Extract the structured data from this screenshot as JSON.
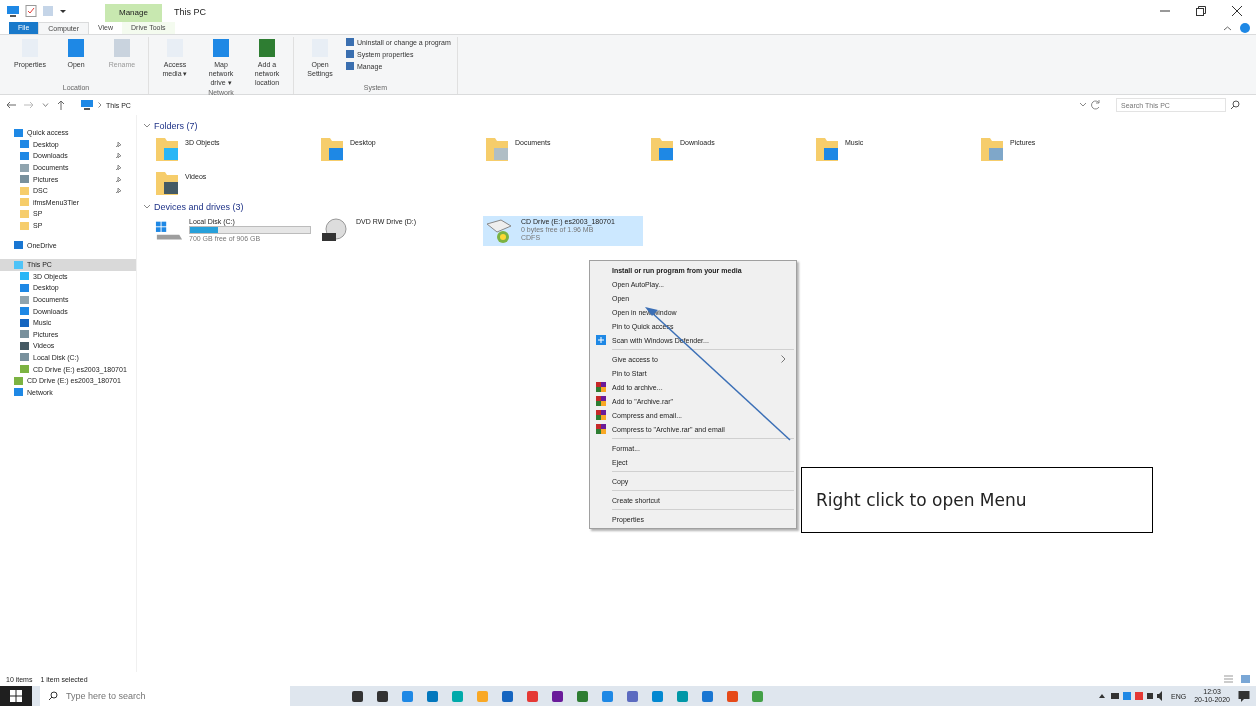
{
  "window": {
    "title": "This PC",
    "context_tab": "Manage"
  },
  "ribbon_tabs": [
    {
      "label": "File",
      "selected": false,
      "kind": "file"
    },
    {
      "label": "Computer",
      "selected": true,
      "kind": "tab"
    },
    {
      "label": "View",
      "selected": false,
      "kind": "tab"
    },
    {
      "label": "Drive Tools",
      "selected": false,
      "kind": "context"
    }
  ],
  "ribbon_groups": [
    {
      "name": "Location",
      "buttons": [
        {
          "label": "Properties",
          "disabled": false
        },
        {
          "label": "Open",
          "disabled": false
        },
        {
          "label": "Rename",
          "disabled": true
        }
      ]
    },
    {
      "name": "Network",
      "buttons": [
        {
          "label": "Access media ▾",
          "disabled": false
        },
        {
          "label": "Map network drive ▾",
          "disabled": false
        },
        {
          "label": "Add a network location",
          "disabled": false
        }
      ]
    },
    {
      "name": "System",
      "buttons": [
        {
          "label": "Open Settings",
          "disabled": false
        }
      ],
      "small_buttons": [
        "Uninstall or change a program",
        "System properties",
        "Manage"
      ]
    }
  ],
  "address": {
    "path": "This PC",
    "search_placeholder": "Search This PC"
  },
  "sidebar": [
    {
      "label": "Quick access",
      "selected": false,
      "children": [
        {
          "label": "Desktop",
          "pinned": true
        },
        {
          "label": "Downloads",
          "pinned": true
        },
        {
          "label": "Documents",
          "pinned": true
        },
        {
          "label": "Pictures",
          "pinned": true
        },
        {
          "label": "DSC",
          "pinned": true
        },
        {
          "label": "ifmsMenu3Tier",
          "pinned": false
        },
        {
          "label": "SP",
          "pinned": false
        },
        {
          "label": "SP",
          "pinned": false
        }
      ]
    },
    {
      "label": "OneDrive",
      "selected": false
    },
    {
      "label": "This PC",
      "selected": true,
      "children": [
        {
          "label": "3D Objects",
          "pinned": false
        },
        {
          "label": "Desktop",
          "pinned": false
        },
        {
          "label": "Documents",
          "pinned": false
        },
        {
          "label": "Downloads",
          "pinned": false
        },
        {
          "label": "Music",
          "pinned": false
        },
        {
          "label": "Pictures",
          "pinned": false
        },
        {
          "label": "Videos",
          "pinned": false
        },
        {
          "label": "Local Disk (C:)",
          "pinned": false
        },
        {
          "label": "CD Drive (E:) es2003_180701",
          "pinned": false
        }
      ]
    },
    {
      "label": "CD Drive (E:) es2003_180701",
      "selected": false
    },
    {
      "label": "Network",
      "selected": false
    }
  ],
  "folders": {
    "heading": "Folders (7)",
    "expanded": true,
    "items": [
      "3D Objects",
      "Desktop",
      "Documents",
      "Downloads",
      "Music",
      "Pictures",
      "Videos"
    ]
  },
  "drives": {
    "heading": "Devices and drives (3)",
    "expanded": true,
    "items": [
      {
        "name": "Local Disk (C:)",
        "level": 0.23,
        "detail": "700 GB free of 906 GB",
        "kind": "disk",
        "selected": false
      },
      {
        "name": "DVD RW Drive (D:)",
        "kind": "dvd",
        "selected": false
      },
      {
        "name": "CD Drive (E:) es2003_180701",
        "detail": "0 bytes free of 1.96 MB",
        "filesystem": "CDFS",
        "kind": "cd",
        "selected": true
      }
    ]
  },
  "context_menu": [
    {
      "label": "Install or run program from your media",
      "kind": "bold"
    },
    {
      "label": "Open AutoPlay...",
      "kind": "plain"
    },
    {
      "label": "Open",
      "kind": "plain"
    },
    {
      "label": "Open in new window",
      "kind": "plain"
    },
    {
      "label": "Pin to Quick access",
      "kind": "plain"
    },
    {
      "label": "Scan with Windows Defender...",
      "kind": "shield"
    },
    {
      "kind": "separator"
    },
    {
      "label": "Give access to",
      "kind": "submenu"
    },
    {
      "label": "Pin to Start",
      "kind": "plain"
    },
    {
      "label": "Add to archive...",
      "kind": "archive"
    },
    {
      "label": "Add to \"Archive.rar\"",
      "kind": "archive"
    },
    {
      "label": "Compress and email...",
      "kind": "archive"
    },
    {
      "label": "Compress to \"Archive.rar\" and email",
      "kind": "archive"
    },
    {
      "kind": "separator"
    },
    {
      "label": "Format...",
      "kind": "plain"
    },
    {
      "label": "Eject",
      "kind": "plain"
    },
    {
      "kind": "separator"
    },
    {
      "label": "Copy",
      "kind": "plain"
    },
    {
      "kind": "separator"
    },
    {
      "label": "Create shortcut",
      "kind": "plain"
    },
    {
      "kind": "separator"
    },
    {
      "label": "Properties",
      "kind": "plain"
    }
  ],
  "callout": {
    "text": "Right click to open Menu"
  },
  "status_bar": {
    "count": "10 items",
    "selection": "1 item selected"
  },
  "taskbar": {
    "search_placeholder": "Type here to search",
    "language": "ENG",
    "time": "12:03",
    "date": "20-10-2020"
  }
}
